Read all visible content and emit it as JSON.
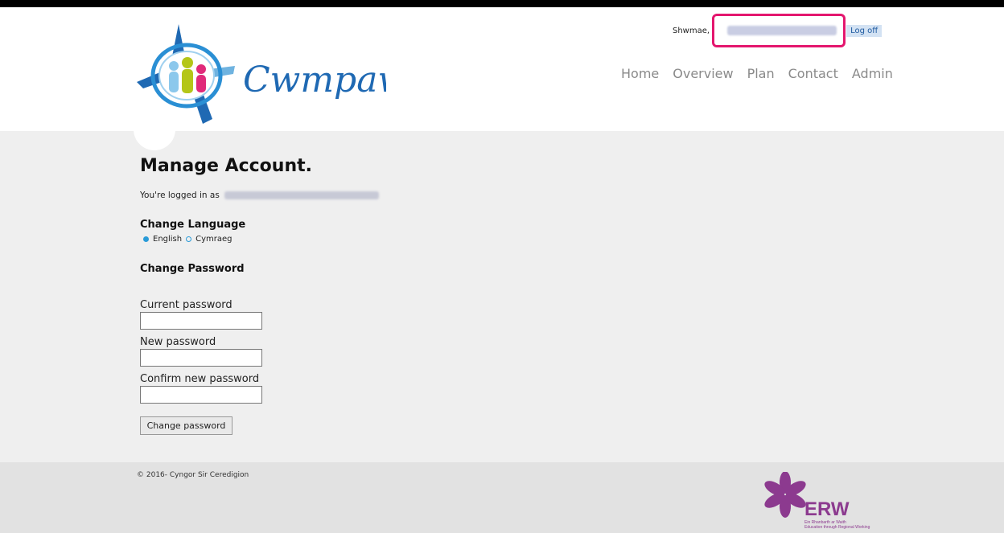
{
  "brand": {
    "name": "Cwmpawd"
  },
  "header": {
    "greeting": "Shwmae,",
    "logoff_label": "Log off",
    "nav": [
      "Home",
      "Overview",
      "Plan",
      "Contact",
      "Admin"
    ]
  },
  "main": {
    "title": "Manage Account.",
    "logged_in_prefix": "You're logged in as",
    "change_language_heading": "Change Language",
    "languages": [
      {
        "label": "English",
        "selected": true
      },
      {
        "label": "Cymraeg",
        "selected": false
      }
    ],
    "change_password_heading": "Change Password",
    "fields": {
      "current": {
        "label": "Current password",
        "value": ""
      },
      "new": {
        "label": "New password",
        "value": ""
      },
      "confirm": {
        "label": "Confirm new password",
        "value": ""
      }
    },
    "submit_label": "Change password"
  },
  "footer": {
    "copyright": "© 2016- Cyngor Sir Ceredigion",
    "partner_name": "ERW",
    "partner_tagline_cy": "Ein Rhanbarth ar Waith",
    "partner_tagline_en": "Education through Regional Working"
  },
  "colors": {
    "accent_blue": "#2a9bd8",
    "highlight_pink": "#e4166e",
    "erw_purple": "#8c3a8f",
    "logo_blue": "#1f69b3"
  }
}
